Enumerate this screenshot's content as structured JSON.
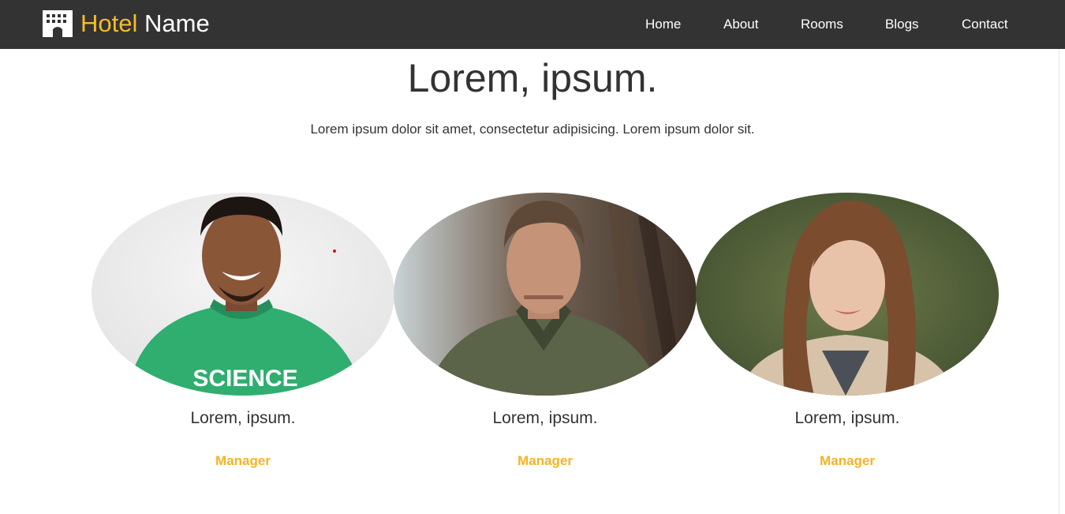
{
  "nav": {
    "brand_part1": "Hotel",
    "brand_part2": "Name",
    "brand_icon": "hotel-building-icon",
    "links": [
      "Home",
      "About",
      "Rooms",
      "Blogs",
      "Contact"
    ]
  },
  "section": {
    "title": "Lorem, ipsum.",
    "subtitle": "Lorem ipsum dolor sit amet, consectetur adipisicing. Lorem ipsum dolor sit."
  },
  "team": [
    {
      "name": "Lorem, ipsum.",
      "role": "Manager"
    },
    {
      "name": "Lorem, ipsum.",
      "role": "Manager"
    },
    {
      "name": "Lorem, ipsum.",
      "role": "Manager"
    }
  ],
  "colors": {
    "navbar": "#333333",
    "accent": "#f5bc2a",
    "role": "#f5b324",
    "text": "#333333"
  }
}
